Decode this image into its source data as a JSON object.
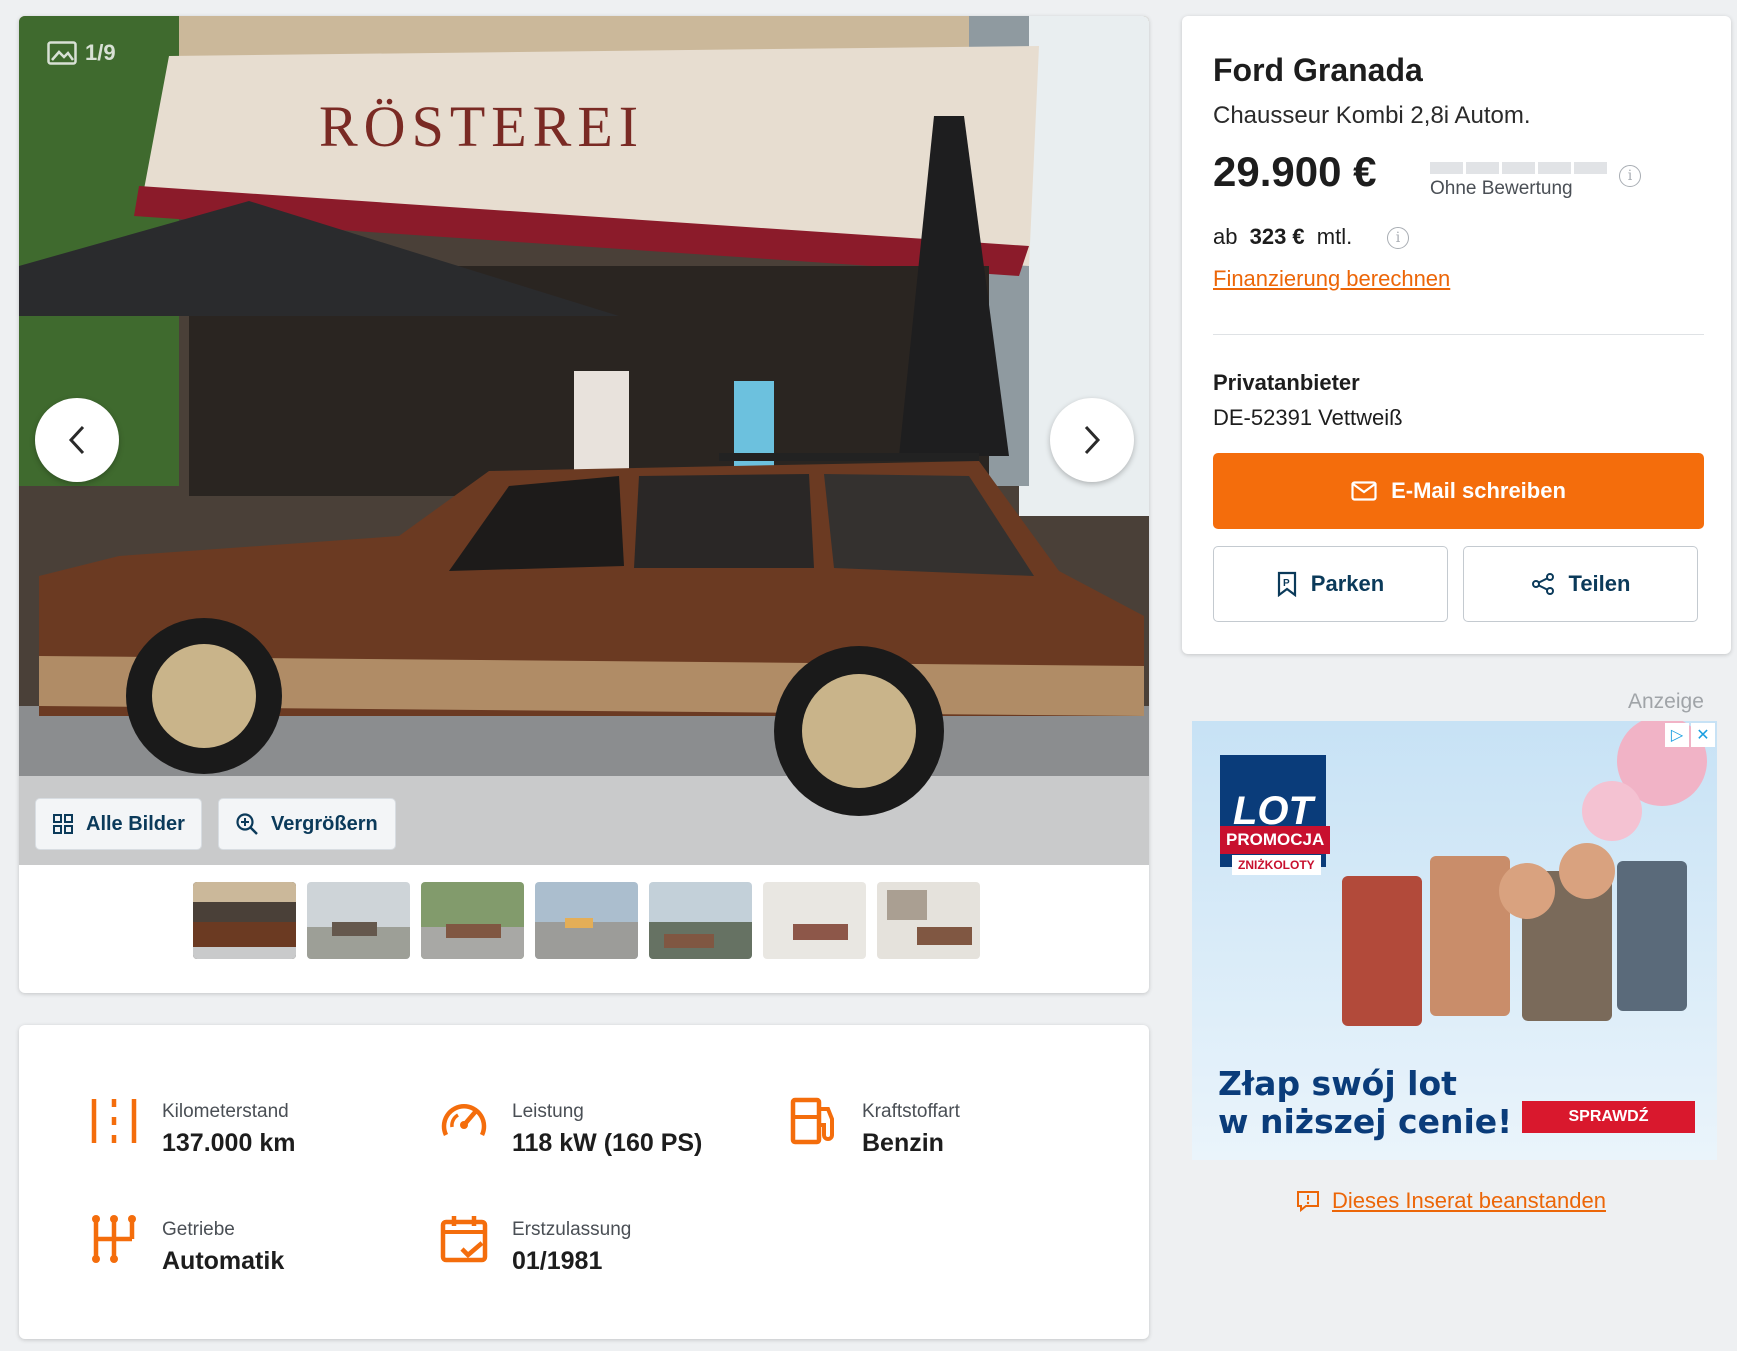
{
  "gallery": {
    "counter": "1/9",
    "all_images_label": "Alle Bilder",
    "zoom_label": "Vergrößern",
    "thumbnail_count": 7
  },
  "listing": {
    "title": "Ford Granada",
    "subtitle": "Chausseur Kombi 2,8i Autom.",
    "price": "29.900 €",
    "rating": "Ohne Bewertung",
    "monthly_prefix": "ab",
    "monthly_amount": "323 €",
    "monthly_suffix": "mtl.",
    "finance_link": "Finanzierung berechnen",
    "seller_type": "Privatanbieter",
    "seller_location": "DE-52391 Vettweiß",
    "email_button": "E-Mail schreiben",
    "park_button": "Parken",
    "share_button": "Teilen"
  },
  "specs": [
    {
      "label": "Kilometerstand",
      "value": "137.000 km",
      "icon": "odometer-icon"
    },
    {
      "label": "Leistung",
      "value": "118 kW (160 PS)",
      "icon": "speedometer-icon"
    },
    {
      "label": "Kraftstoffart",
      "value": "Benzin",
      "icon": "fuel-pump-icon"
    },
    {
      "label": "Getriebe",
      "value": "Automatik",
      "icon": "gearbox-icon"
    },
    {
      "label": "Erstzulassung",
      "value": "01/1981",
      "icon": "calendar-icon"
    }
  ],
  "ad": {
    "label": "Anzeige",
    "logo": "LOT",
    "promo": "PROMOCJA",
    "promo_sub": "ZNIŻKOLOTY",
    "headline_line1": "Złap swój lot",
    "headline_line2": "w niższej cenie!",
    "cta": "SPRAWDŹ"
  },
  "report_link": "Dieses Inserat beanstanden",
  "colors": {
    "accent": "#f46d0c",
    "link": "#ec6608",
    "button_text": "#0b3a5a",
    "background": "#eef0f2"
  }
}
